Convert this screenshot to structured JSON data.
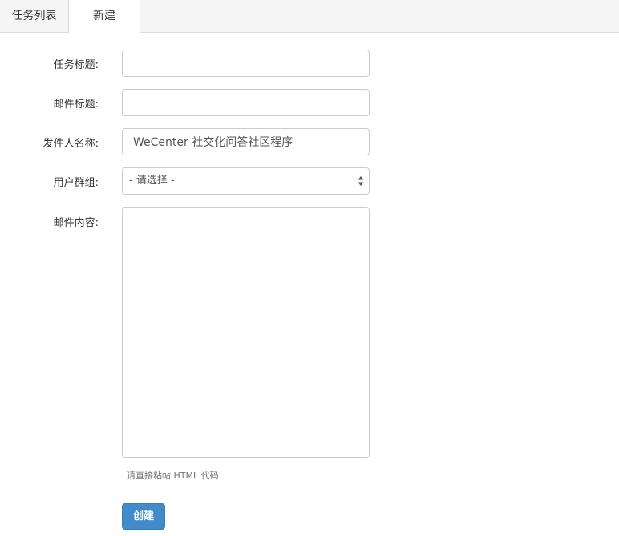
{
  "tabs": {
    "list_label": "任务列表",
    "new_label": "新建"
  },
  "form": {
    "task_title_label": "任务标题:",
    "task_title_value": "",
    "mail_subject_label": "邮件标题:",
    "mail_subject_value": "",
    "sender_name_label": "发件人名称:",
    "sender_name_value": "WeCenter 社交化问答社区程序",
    "user_group_label": "用户群组:",
    "user_group_selected": "- 请选择 -",
    "mail_content_label": "邮件内容:",
    "mail_content_value": "",
    "mail_content_help": "请直接粘帖 HTML 代码",
    "submit_label": "创建"
  },
  "icons": {
    "select_arrows": "select-arrows-icon"
  },
  "colors": {
    "primary": "#428bca",
    "border": "#cccccc",
    "tabbar": "#f5f5f5"
  }
}
